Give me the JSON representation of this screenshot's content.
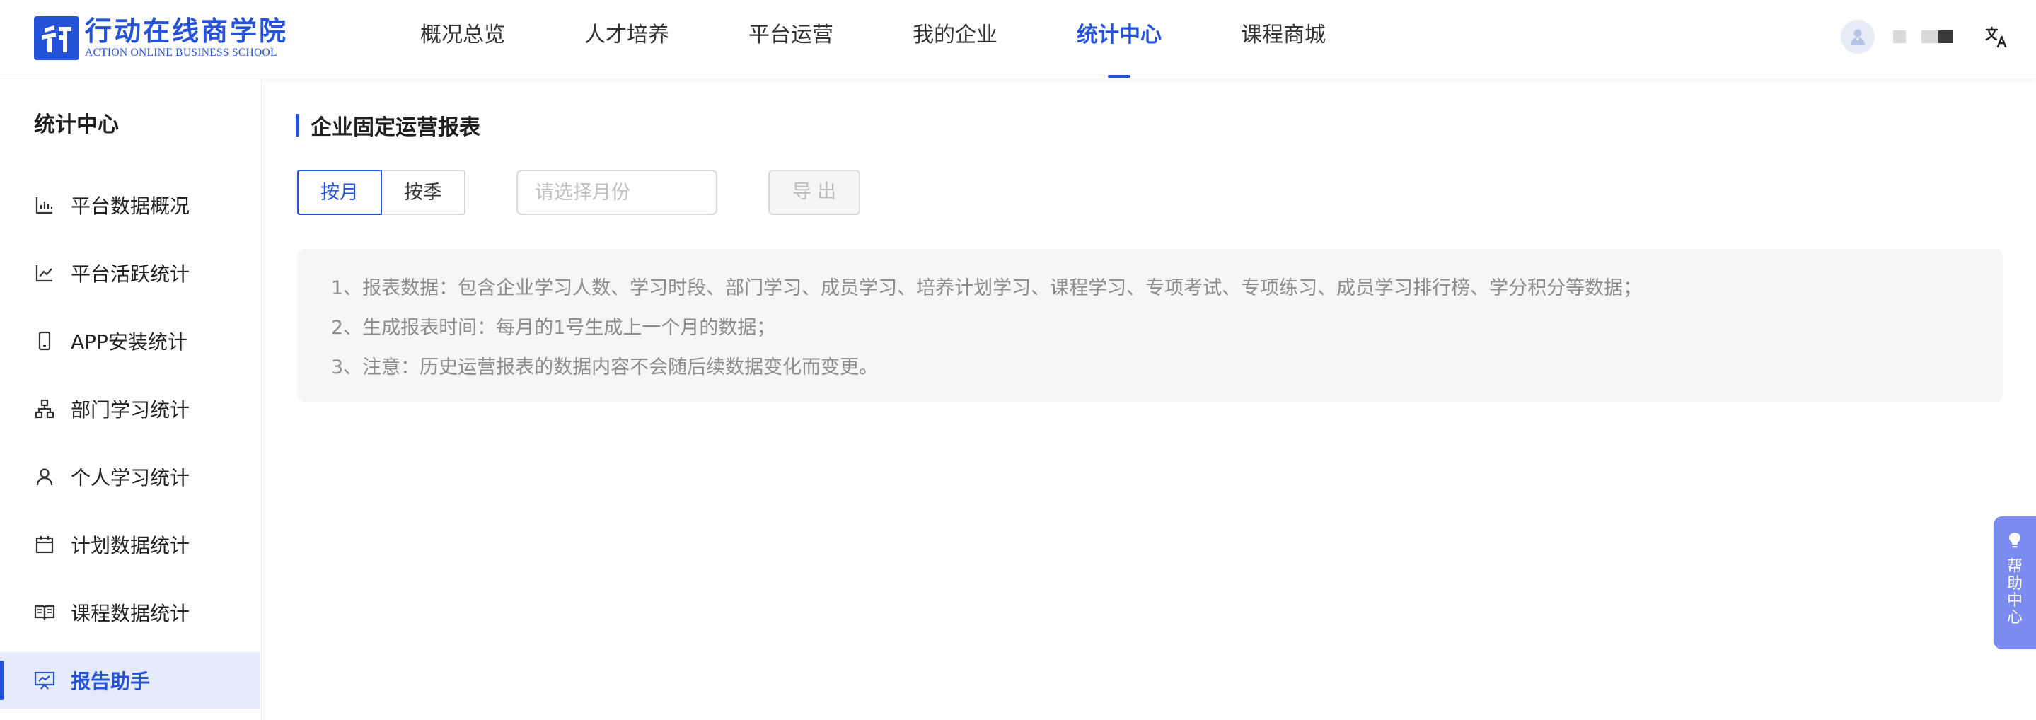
{
  "brand": {
    "name_cn": "行动在线商学院",
    "name_en": "ACTION ONLINE BUSINESS SCHOOL",
    "color": "#2452d9"
  },
  "nav": {
    "items": [
      {
        "label": "概况总览"
      },
      {
        "label": "人才培养"
      },
      {
        "label": "平台运营"
      },
      {
        "label": "我的企业"
      },
      {
        "label": "统计中心"
      },
      {
        "label": "课程商城"
      }
    ],
    "active": "统计中心"
  },
  "header": {
    "avatar_icon": "user-avatar-icon",
    "language_icon": "translate-icon"
  },
  "sidebar": {
    "title": "统计中心",
    "items": [
      {
        "label": "平台数据概况",
        "icon": "bar-chart-icon"
      },
      {
        "label": "平台活跃统计",
        "icon": "line-chart-icon"
      },
      {
        "label": "APP安装统计",
        "icon": "mobile-phone-icon"
      },
      {
        "label": "部门学习统计",
        "icon": "org-tree-icon"
      },
      {
        "label": "个人学习统计",
        "icon": "person-icon"
      },
      {
        "label": "计划数据统计",
        "icon": "calendar-icon"
      },
      {
        "label": "课程数据统计",
        "icon": "open-book-icon"
      },
      {
        "label": "报告助手",
        "icon": "report-screen-icon"
      }
    ],
    "active": "报告助手"
  },
  "main": {
    "section_title": "企业固定运营报表",
    "period_toggle": {
      "options": [
        "按月",
        "按季"
      ],
      "selected": "按月"
    },
    "month_picker": {
      "value": "",
      "placeholder": "请选择月份",
      "icon": "calendar-icon"
    },
    "export_label": "导出",
    "notes": [
      "1、报表数据：包含企业学习人数、学习时段、部门学习、成员学习、培养计划学习、课程学习、专项考试、专项练习、成员学习排行榜、学分积分等数据；",
      "2、生成报表时间：每月的1号生成上一个月的数据；",
      "3、注意：历史运营报表的数据内容不会随后续数据变化而变更。"
    ]
  },
  "help": {
    "label": "帮助中心",
    "icon": "lightbulb-icon"
  }
}
